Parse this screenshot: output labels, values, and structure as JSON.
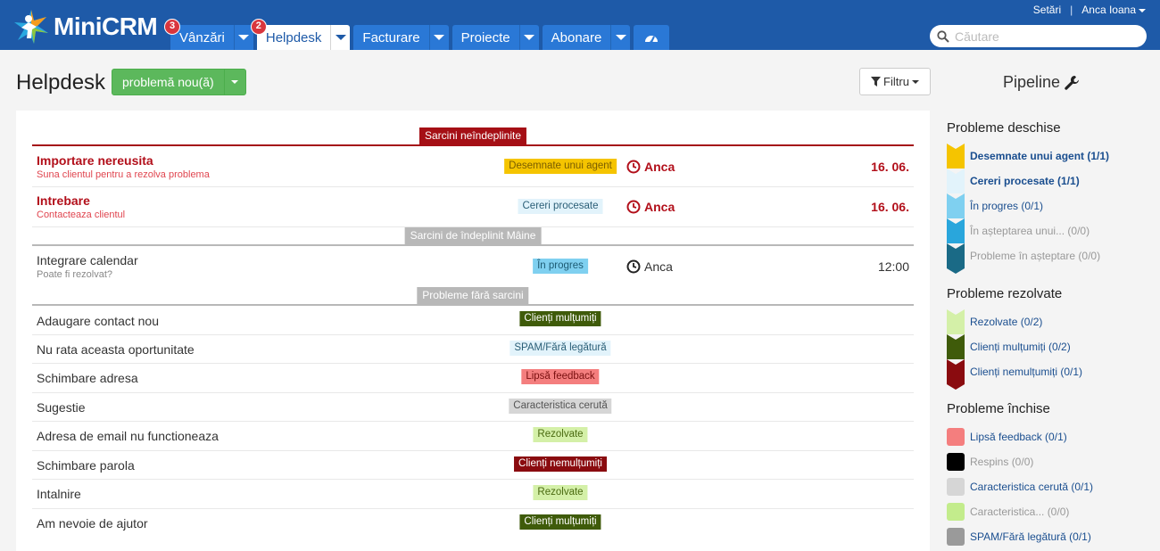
{
  "app": {
    "name": "MiniCRM"
  },
  "topbar": {
    "tabs": [
      {
        "label": "Vânzări",
        "badge": "3"
      },
      {
        "label": "Helpdesk",
        "badge": "2"
      },
      {
        "label": "Facturare"
      },
      {
        "label": "Proiecte"
      },
      {
        "label": "Abonare"
      }
    ],
    "dashboard_icon": "dashboard-icon",
    "settings_label": "Setări",
    "separator": "|",
    "user_name": "Anca Ioana",
    "search_placeholder": "Căutare"
  },
  "header": {
    "title": "Helpdesk",
    "new_button": "problemă nou(ă)",
    "filter_button": "Filtru",
    "pipeline_title": "Pipeline"
  },
  "sections": {
    "overdue": {
      "label": "Sarcini neîndeplinite",
      "color": "#a50f15"
    },
    "tomorrow": {
      "label": "Sarcini de îndeplinit Mâine",
      "color": "#b8b8b8"
    },
    "none": {
      "label": "Probleme fără sarcini",
      "color": "#b8b8b8"
    }
  },
  "tasks_overdue": [
    {
      "title": "Importare nereusita",
      "sub": "Suna clientul pentru a rezolva problema",
      "status": "Desemnate unui agent",
      "owner": "Anca",
      "date": "16. 06."
    },
    {
      "title": "Intrebare",
      "sub": "Contacteaza clientul",
      "status": "Cereri procesate",
      "owner": "Anca",
      "date": "16. 06."
    }
  ],
  "tasks_tomorrow": [
    {
      "title": "Integrare calendar",
      "sub": "Poate fi rezolvat?",
      "status": "În progres",
      "owner": "Anca",
      "date": "12:00"
    }
  ],
  "tasks_none": [
    {
      "title": "Adaugare contact nou",
      "status": "Clienți mulțumiți"
    },
    {
      "title": "Nu rata aceasta oportunitate",
      "status": "SPAM/Fără legătură"
    },
    {
      "title": "Schimbare adresa",
      "status": "Lipsă feedback"
    },
    {
      "title": "Sugestie",
      "status": "Caracteristica cerută"
    },
    {
      "title": "Adresa de email nu functioneaza",
      "status": "Rezolvate"
    },
    {
      "title": "Schimbare parola",
      "status": "Clienți nemulțumiți"
    },
    {
      "title": "Intalnire",
      "status": "Rezolvate"
    },
    {
      "title": "Am nevoie de ajutor",
      "status": "Clienți mulțumiți"
    }
  ],
  "pipeline": {
    "open": {
      "title": "Probleme deschise",
      "items": [
        {
          "label": "Desemnate unui agent (1/1)",
          "color": "#f5c400"
        },
        {
          "label": "Cereri procesate (1/1)",
          "color": "#e2f3fb"
        },
        {
          "label": "În progres (0/1)",
          "color": "#7fd0f0"
        },
        {
          "label": "În așteptarea unui... (0/0)",
          "color": "#29a6dc"
        },
        {
          "label": "Probleme în așteptare (0/0)",
          "color": "#1a6a86"
        }
      ]
    },
    "resolved": {
      "title": "Probleme rezolvate",
      "items": [
        {
          "label": "Rezolvate (0/2)",
          "color": "#d4f0a8"
        },
        {
          "label": "Clienți mulțumiți (0/2)",
          "color": "#3f5b0a"
        },
        {
          "label": "Clienți nemulțumiți (0/1)",
          "color": "#8a0b0f"
        }
      ]
    },
    "closed": {
      "title": "Probleme închise",
      "items": [
        {
          "label": "Lipsă feedback (0/1)",
          "color": "#f47e7e"
        },
        {
          "label": "Respins (0/0)",
          "color": "#000000"
        },
        {
          "label": "Caracteristica cerută (0/1)",
          "color": "#d6d6d6"
        },
        {
          "label": "Caracteristica... (0/0)",
          "color": "#c3ec8c"
        },
        {
          "label": "SPAM/Fără legătură (0/1)",
          "color": "#9a9a9a"
        }
      ]
    }
  }
}
